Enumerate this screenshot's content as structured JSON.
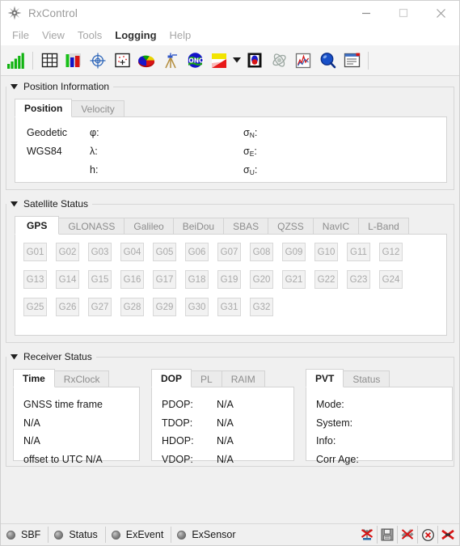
{
  "window": {
    "title": "RxControl",
    "app_icon": "compass-rose-icon",
    "controls": {
      "minimize": "minimize-icon",
      "maximize": "maximize-icon",
      "close": "close-icon"
    }
  },
  "menubar": {
    "items": [
      {
        "label": "File",
        "active": false
      },
      {
        "label": "View",
        "active": false
      },
      {
        "label": "Tools",
        "active": false
      },
      {
        "label": "Logging",
        "active": true
      },
      {
        "label": "Help",
        "active": false
      }
    ]
  },
  "toolbar": {
    "buttons": [
      {
        "name": "signal-bars-icon",
        "title": "Signal Levels"
      },
      {
        "name": "separator",
        "title": ""
      },
      {
        "name": "grid-table-icon",
        "title": "Satellite Visibility"
      },
      {
        "name": "bar-chart-icon",
        "title": "Bar Chart"
      },
      {
        "name": "crosshair-target-icon",
        "title": "Position Scatter"
      },
      {
        "name": "scatter-plot-icon",
        "title": "Sky Plot"
      },
      {
        "name": "pie-chart-icon",
        "title": "Pie Chart"
      },
      {
        "name": "survey-tripod-icon",
        "title": "Base Station"
      },
      {
        "name": "iono-globe-icon",
        "title": "Ionosphere"
      },
      {
        "name": "spectrum-icon",
        "title": "Spectrum"
      },
      {
        "name": "dropdown-arrow-icon",
        "title": "More"
      },
      {
        "name": "antenna-monitor-icon",
        "title": "Antenna"
      },
      {
        "name": "satellite-orbit-icon",
        "title": "Orbits"
      },
      {
        "name": "graph-window-icon",
        "title": "Graph"
      },
      {
        "name": "magnifier-icon",
        "title": "Search"
      },
      {
        "name": "log-window-icon",
        "title": "Logs"
      }
    ]
  },
  "position_information": {
    "title": "Position Information",
    "expanded": true,
    "tabs": [
      {
        "label": "Position",
        "selected": true
      },
      {
        "label": "Velocity",
        "selected": false
      }
    ],
    "datum_lines": [
      "Geodetic",
      "WGS84"
    ],
    "fields": [
      {
        "label": "φ:",
        "value": ""
      },
      {
        "label": "λ:",
        "value": ""
      },
      {
        "label": "h:",
        "value": ""
      }
    ],
    "sigma_fields": [
      {
        "label": "σ",
        "sub": "N",
        "suffix": ":",
        "value": ""
      },
      {
        "label": "σ",
        "sub": "E",
        "suffix": ":",
        "value": ""
      },
      {
        "label": "σ",
        "sub": "U",
        "suffix": ":",
        "value": ""
      }
    ]
  },
  "satellite_status": {
    "title": "Satellite Status",
    "expanded": true,
    "tabs": [
      {
        "label": "GPS",
        "selected": true
      },
      {
        "label": "GLONASS",
        "selected": false
      },
      {
        "label": "Galileo",
        "selected": false
      },
      {
        "label": "BeiDou",
        "selected": false
      },
      {
        "label": "SBAS",
        "selected": false
      },
      {
        "label": "QZSS",
        "selected": false
      },
      {
        "label": "NavIC",
        "selected": false
      },
      {
        "label": "L-Band",
        "selected": false
      }
    ],
    "satellites": [
      "G01",
      "G02",
      "G03",
      "G04",
      "G05",
      "G06",
      "G07",
      "G08",
      "G09",
      "G10",
      "G11",
      "G12",
      "G13",
      "G14",
      "G15",
      "G16",
      "G17",
      "G18",
      "G19",
      "G20",
      "G21",
      "G22",
      "G23",
      "G24",
      "G25",
      "G26",
      "G27",
      "G28",
      "G29",
      "G30",
      "G31",
      "G32"
    ]
  },
  "receiver_status": {
    "title": "Receiver Status",
    "expanded": true,
    "time_block": {
      "tabs": [
        {
          "label": "Time",
          "selected": true
        },
        {
          "label": "RxClock",
          "selected": false
        }
      ],
      "lines": [
        "GNSS time frame",
        "N/A",
        "N/A",
        "offset to UTC N/A"
      ]
    },
    "dop_block": {
      "tabs": [
        {
          "label": "DOP",
          "selected": true
        },
        {
          "label": "PL",
          "selected": false
        },
        {
          "label": "RAIM",
          "selected": false
        }
      ],
      "rows": [
        {
          "key": "PDOP:",
          "value": "N/A"
        },
        {
          "key": "TDOP:",
          "value": "N/A"
        },
        {
          "key": "HDOP:",
          "value": "N/A"
        },
        {
          "key": "VDOP:",
          "value": "N/A"
        }
      ]
    },
    "pvt_block": {
      "tabs": [
        {
          "label": "PVT",
          "selected": true
        },
        {
          "label": "Status",
          "selected": false
        }
      ],
      "rows": [
        {
          "key": "Mode:",
          "value": ""
        },
        {
          "key": "System:",
          "value": ""
        },
        {
          "key": "Info:",
          "value": ""
        },
        {
          "key": "Corr Age:",
          "value": ""
        }
      ]
    }
  },
  "statusbar": {
    "indicators": [
      {
        "label": "SBF",
        "led": "led-gray"
      },
      {
        "label": "Status",
        "led": "led-gray"
      },
      {
        "label": "ExEvent",
        "led": "led-gray"
      },
      {
        "label": "ExSensor",
        "led": "led-gray"
      }
    ],
    "right_icons": [
      {
        "name": "no-antenna-icon"
      },
      {
        "name": "disk-logging-icon"
      },
      {
        "name": "no-satellite-icon"
      },
      {
        "name": "no-connection-icon"
      },
      {
        "name": "disconnect-icon"
      }
    ]
  },
  "colors": {
    "window_bg": "#f0f0f0",
    "panel_bg": "#ffffff",
    "border": "#d6d6d6",
    "text": "#1a1a1a",
    "muted_text": "#a9a9a9",
    "title_text": "#9a9a9a",
    "accent_red": "#d40000",
    "accent_green": "#00a000",
    "accent_blue": "#1050c0"
  }
}
